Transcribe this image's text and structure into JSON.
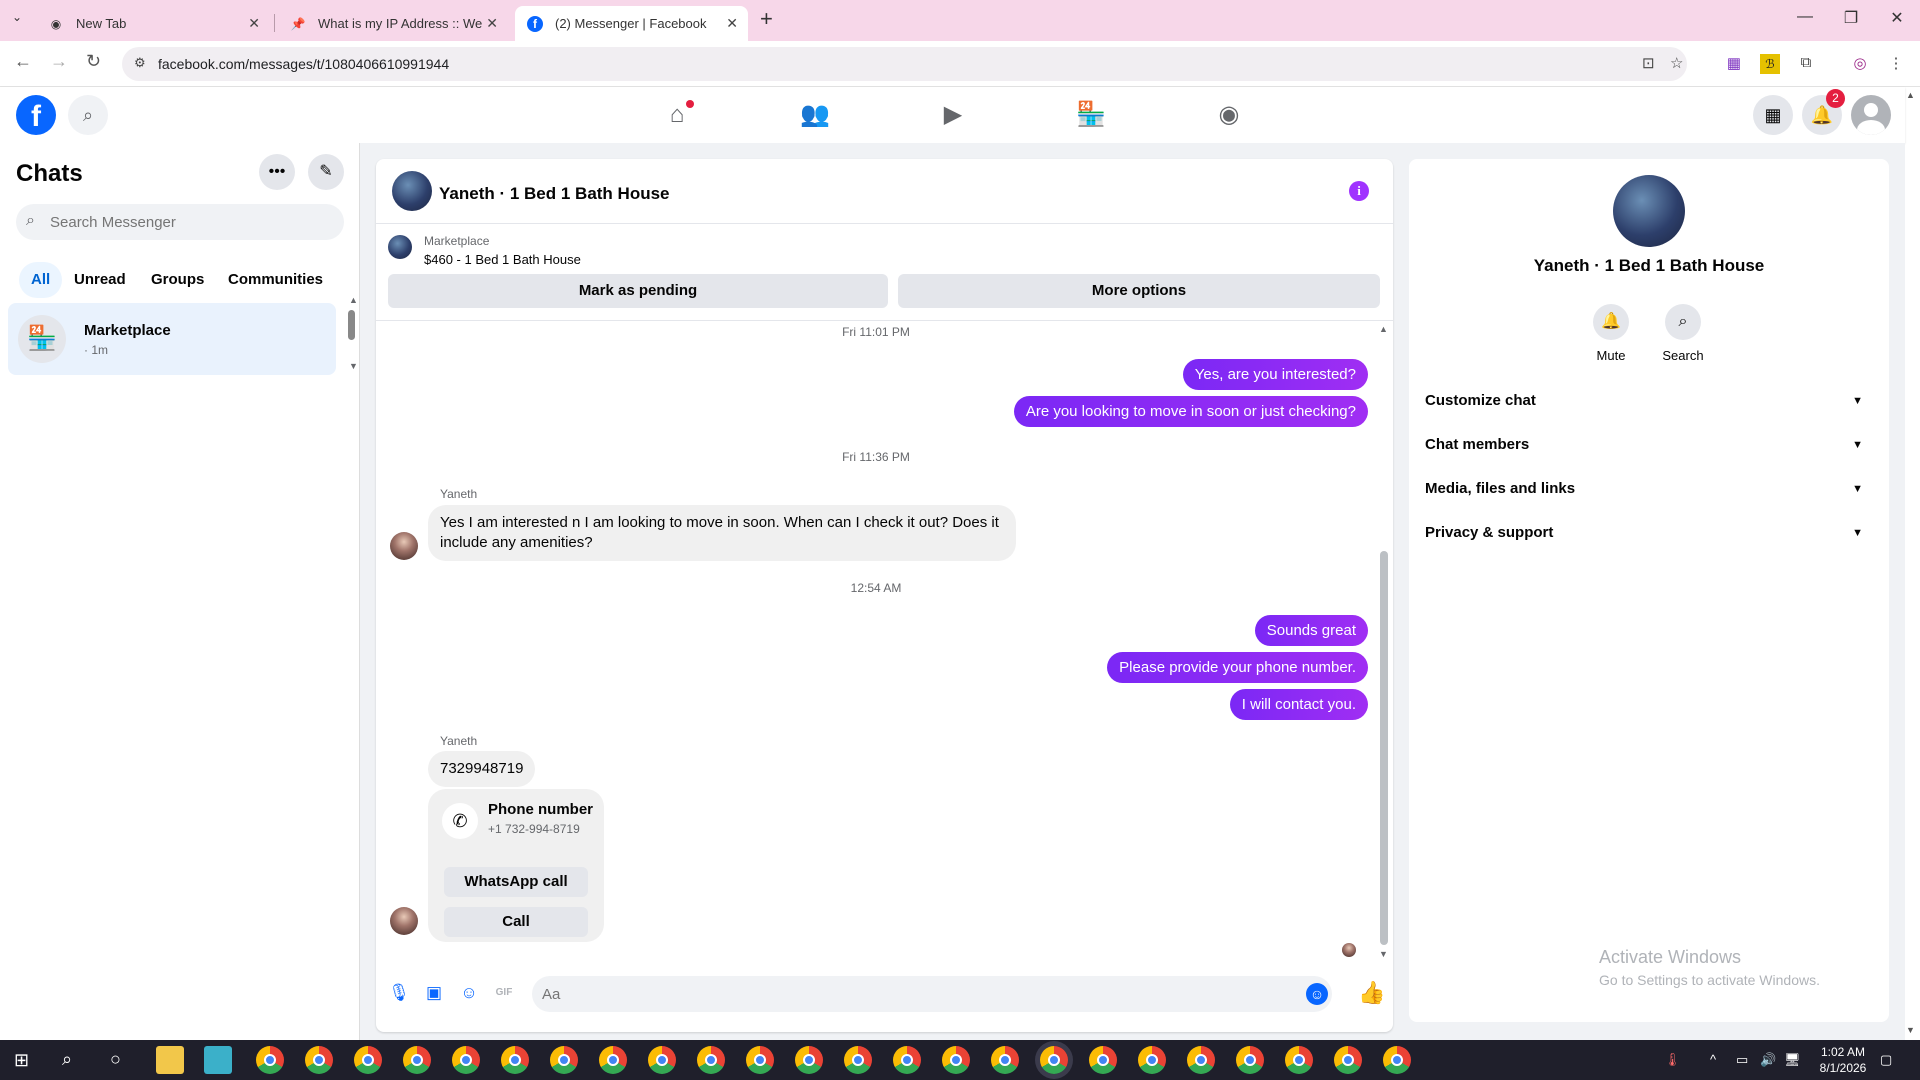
{
  "browser": {
    "tabs": [
      {
        "title": "New Tab",
        "icon": "chrome-icon"
      },
      {
        "title": "What is my IP Address :: WebB",
        "icon": "pin-icon"
      },
      {
        "title": "(2) Messenger | Facebook",
        "icon": "facebook-icon",
        "active": true
      }
    ],
    "url": "facebook.com/messages/t/1080406610991944"
  },
  "fb_header": {
    "notification_count": "2"
  },
  "sidebar": {
    "title": "Chats",
    "search_placeholder": "Search Messenger",
    "filters": [
      "All",
      "Unread",
      "Groups",
      "Communities"
    ],
    "chats": [
      {
        "name": "Marketplace",
        "time": "· 1m"
      }
    ]
  },
  "conversation": {
    "title": "Yaneth · 1 Bed 1 Bath House",
    "marketplace_label": "Marketplace",
    "marketplace_item": "$460 - 1 Bed 1 Bath House",
    "actions": [
      "Mark as pending",
      "More options"
    ],
    "timestamps": [
      "Fri 11:01 PM",
      "Fri 11:36 PM",
      "12:54 AM"
    ],
    "outgoing_1": [
      "Yes, are you interested?",
      "Are you looking to move in soon or just checking?"
    ],
    "sender_name": "Yaneth",
    "incoming_1": "Yes I am interested n I am looking to move in soon. When can I check it out? Does it include any amenities?",
    "outgoing_2": [
      "Sounds great",
      "Please provide your phone number.",
      "I will contact you."
    ],
    "incoming_2": "7329948719",
    "phone_card": {
      "title": "Phone number",
      "number": "+1 732-994-8719",
      "buttons": [
        "WhatsApp call",
        "Call"
      ]
    },
    "composer_placeholder": "Aa"
  },
  "info_panel": {
    "name": "Yaneth · 1 Bed 1 Bath House",
    "actions": [
      "Mute",
      "Search"
    ],
    "sections": [
      "Customize chat",
      "Chat members",
      "Media, files and links",
      "Privacy & support"
    ]
  },
  "watermark": {
    "line1": "Activate Windows",
    "line2": "Go to Settings to activate Windows."
  },
  "taskbar": {
    "time": "1:02 AM",
    "date": "8/1/2026"
  },
  "colors": {
    "facebook_blue": "#0866ff",
    "message_purple": "#8a2ef5",
    "tab_bar": "#f7d7e9"
  }
}
